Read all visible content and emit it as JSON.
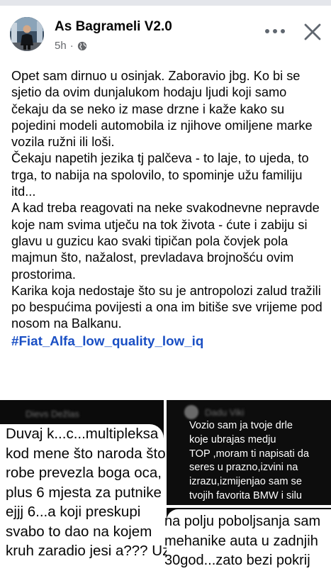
{
  "post": {
    "author": "As Bagrameli V2.0",
    "time": "5h",
    "dot": "·",
    "paragraphs": [
      "Opet sam dirnuo u osinjak. Zaboravio jbg. Ko bi se sjetio da ovim dunjalukom hodaju ljudi koji samo čekaju da se neko iz mase drzne i kaže kako su pojedini modeli automobila iz njihove omiljene marke vozila ružni ili loši.",
      "Čekaju napetih jezika tj palčeva - to laje, to ujeda, to trga, to nabija na spolovilo, to spominje užu familiju itd...",
      "A kad treba reagovati na neke svakodnevne nepravde koje nam svima utječu na tok života - ćute i zabiju si glavu u guzicu kao svaki tipičan pola čovjek pola majmun što, nažalost, prevladava brojnošću ovim prostorima.",
      "Karika koja nedostaje što su je antropolozi zalud tražili po bespućima povijesti a ona im bitiše sve vrijeme pod nosom na Balkanu."
    ],
    "hashtag": "#Fiat_Alfa_low_quality_low_iq"
  },
  "icons": {
    "privacy": "globe-icon",
    "more": "more-options-icon",
    "close": "close-icon"
  },
  "screenshots": {
    "left": {
      "commenter": "Dievs Dežlas",
      "lines": [
        "Duvaj k...c...multipleksa",
        "kod mene što naroda što",
        "robe prevezla boga oca,",
        "plus 6 mjesta za putnike",
        "ejjj 6...a koji preskupi",
        "svabo to dao na kojem",
        "kruh zaradio jesi a??? Uz"
      ]
    },
    "right_top": {
      "commenter": "Dadu Viki",
      "lines": [
        "Vozio sam ja tvoje drle",
        "koje ubrajas medju",
        "TOP ,moram ti napisati da",
        "seres u prazno,izvini na",
        "izrazu,izmijenjao sam se",
        "tvojih favorita BMW i silu"
      ]
    },
    "right_bottom": {
      "lines": [
        "na polju poboljsanja sam",
        "mehanike auta u zadnjih",
        "30god...zato bezi pokrij"
      ]
    }
  },
  "colors": {
    "hashtag": "#1a4fc4",
    "meta": "#65676b",
    "text": "#050505"
  }
}
